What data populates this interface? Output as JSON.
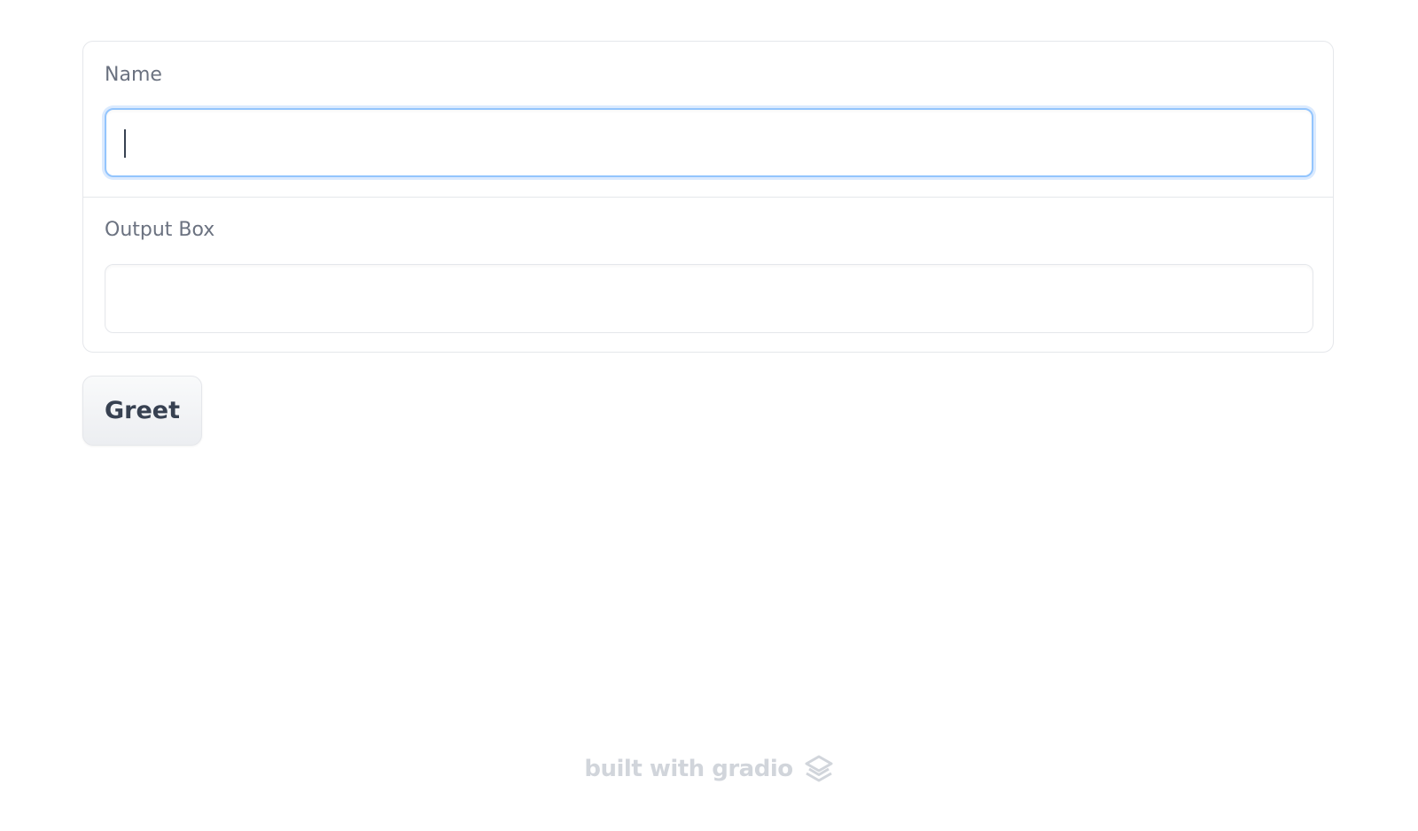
{
  "form": {
    "name_label": "Name",
    "name_value": "",
    "name_placeholder": "",
    "output_label": "Output Box",
    "output_value": ""
  },
  "actions": {
    "greet_label": "Greet"
  },
  "footer": {
    "text": "built with gradio",
    "logo_icon": "gradio-logo-icon"
  },
  "colors": {
    "focus_border": "#93c5fd",
    "label": "#6b7280",
    "footer": "#d1d5db"
  }
}
